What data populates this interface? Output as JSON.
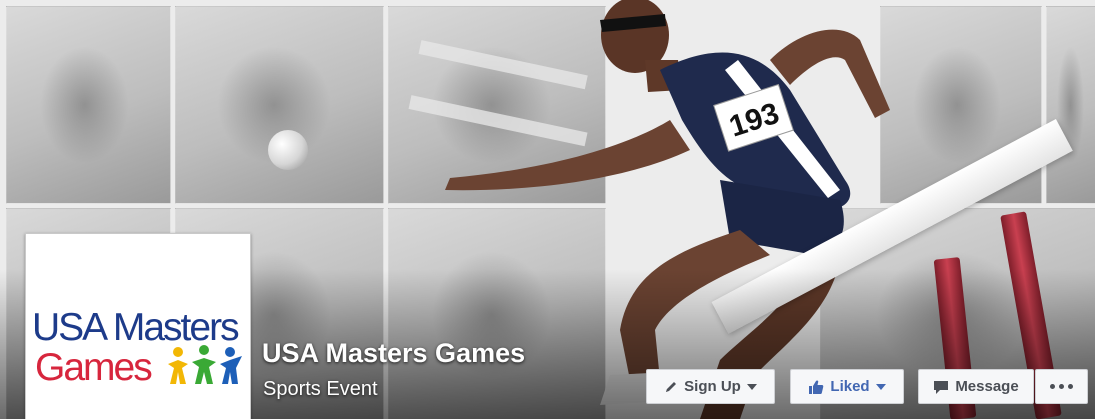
{
  "page": {
    "name": "USA Masters Games",
    "category": "Sports Event"
  },
  "profile_logo": {
    "line1": "USA Masters",
    "line2": "Games"
  },
  "athlete_bib": "193",
  "actions": {
    "sign_up_label": "Sign Up",
    "sign_up_icon": "pencil-icon",
    "liked_label": "Liked",
    "liked_icon": "thumbs-up-icon",
    "message_label": "Message",
    "message_icon": "chat-bubble-icon",
    "more_icon": "ellipsis-icon"
  },
  "colors": {
    "liked_blue": "#4267b2",
    "logo_blue": "#1d3b8a",
    "logo_red": "#d7263d",
    "button_bg": "#f6f7f9"
  }
}
